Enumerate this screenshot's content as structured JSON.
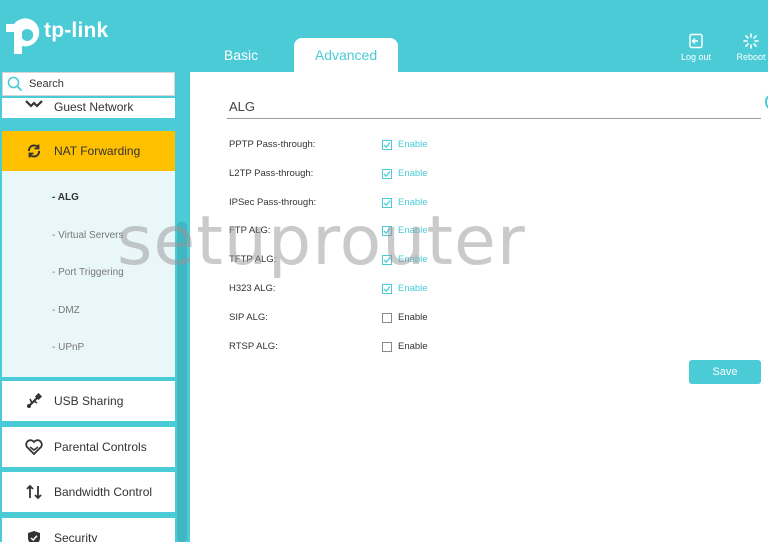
{
  "brand": {
    "logo_text": "tp-link"
  },
  "tabs": [
    {
      "label": "Basic",
      "active": false
    },
    {
      "label": "Advanced",
      "active": true
    }
  ],
  "header_actions": {
    "logout_label": "Log out",
    "reboot_label": "Reboot"
  },
  "sidebar": {
    "search_placeholder": "Search",
    "items": {
      "guest": "Guest Network",
      "nat": "NAT Forwarding",
      "usb": "USB Sharing",
      "parental": "Parental Controls",
      "bandwidth": "Bandwidth Control",
      "security": "Security"
    },
    "nat_subitems": [
      "- ALG",
      "- Virtual Servers",
      "- Port Triggering",
      "- DMZ",
      "- UPnP"
    ],
    "active_subitem": "- ALG"
  },
  "main": {
    "section_title": "ALG",
    "checkbox_label": "Enable",
    "rows": [
      {
        "label": "PPTP Pass-through:",
        "checked": true
      },
      {
        "label": "L2TP Pass-through:",
        "checked": true
      },
      {
        "label": "IPSec Pass-through:",
        "checked": true
      },
      {
        "label": "FTP ALG:",
        "checked": true
      },
      {
        "label": "TFTP ALG:",
        "checked": true
      },
      {
        "label": "H323 ALG:",
        "checked": true
      },
      {
        "label": "SIP ALG:",
        "checked": false
      },
      {
        "label": "RTSP ALG:",
        "checked": false
      }
    ],
    "save_label": "Save"
  },
  "watermark": "setuprouter",
  "colors": {
    "accent": "#4acbd6",
    "active_nav": "#ffc000",
    "submenu_bg": "#eaf7f8"
  }
}
